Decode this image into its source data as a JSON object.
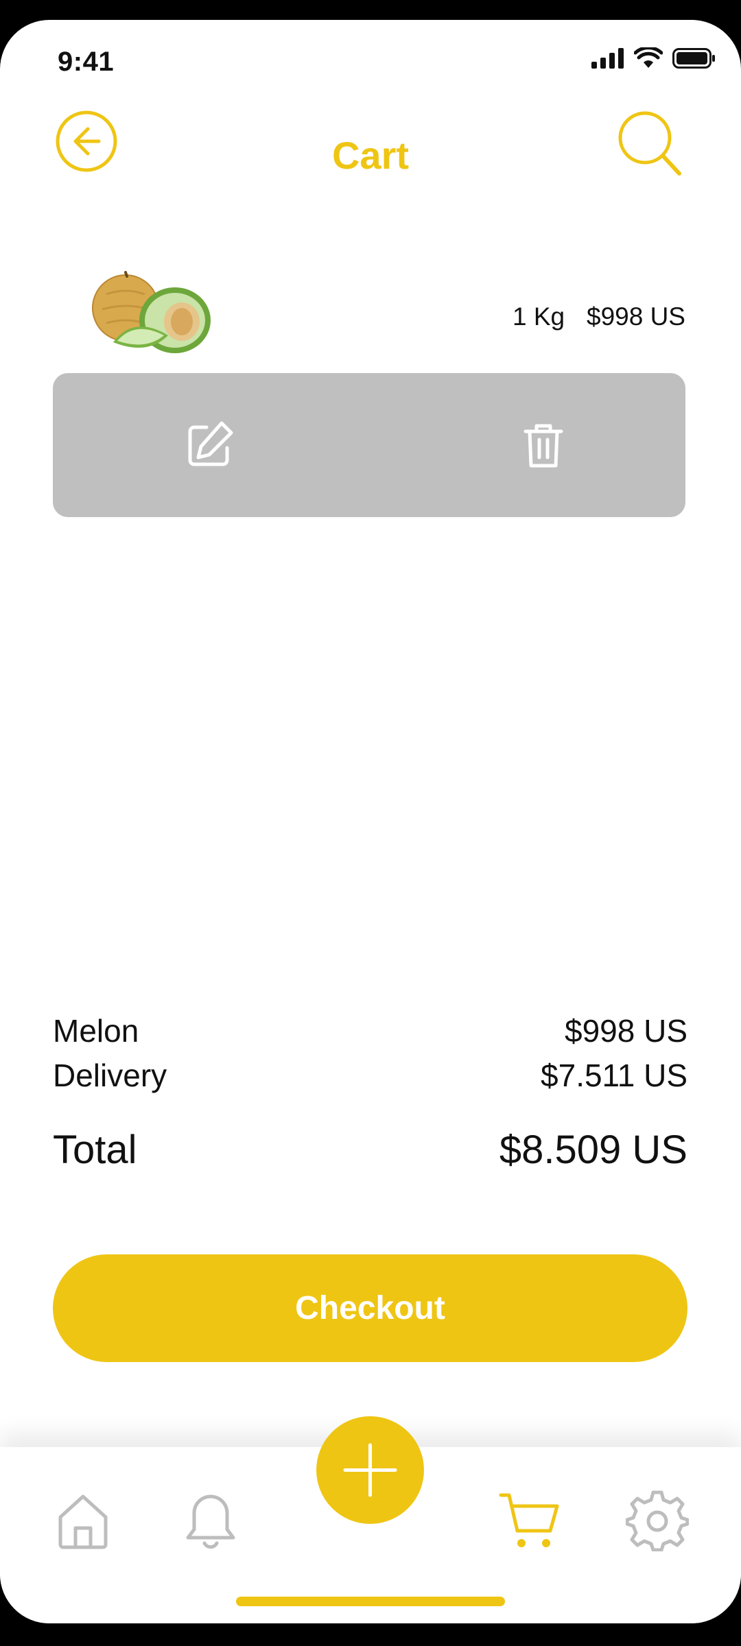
{
  "status_bar": {
    "time": "9:41"
  },
  "header": {
    "title": "Cart"
  },
  "cart_item": {
    "quantity": "1 Kg",
    "price": "$998 US"
  },
  "summary": {
    "rows": [
      {
        "label": "Melon",
        "value": "$998 US"
      },
      {
        "label": "Delivery",
        "value": "$7.511 US"
      }
    ],
    "total": {
      "label": "Total",
      "value": "$8.509 US"
    }
  },
  "checkout": {
    "label": "Checkout"
  },
  "nav": {
    "items": [
      "home-icon",
      "bell-icon",
      "plus-icon",
      "cart-icon",
      "gear-icon"
    ],
    "active": "cart-icon"
  },
  "colors": {
    "accent": "#EFC514",
    "action_bar": "#BFBFBF",
    "inactive_icon": "#BDBDBD"
  }
}
